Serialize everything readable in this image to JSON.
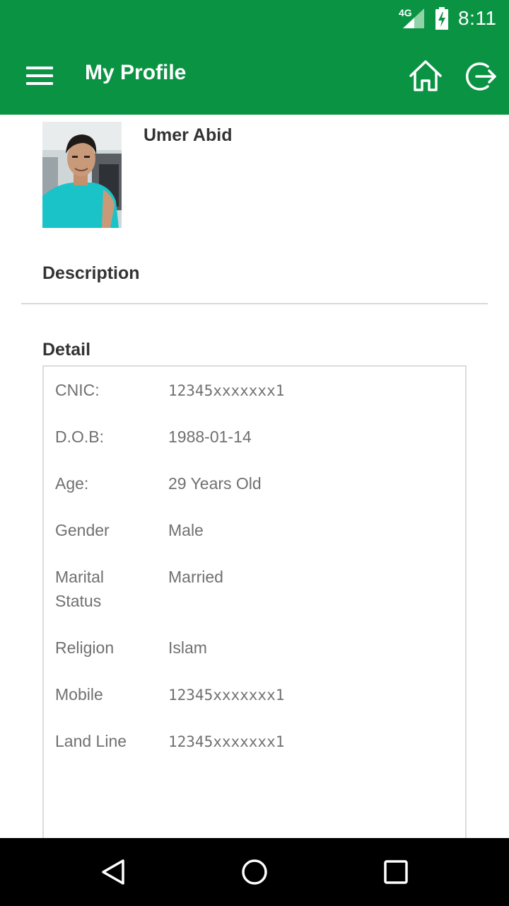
{
  "status_bar": {
    "network": "4G",
    "time": "8:11",
    "icons": [
      "signal-icon",
      "battery-charging-icon"
    ]
  },
  "app_bar": {
    "title": "My Profile",
    "icons": [
      "menu-icon",
      "home-icon",
      "logout-icon"
    ],
    "color": "#0b9344"
  },
  "profile": {
    "name": "Umer Abid"
  },
  "description": {
    "heading": "Description"
  },
  "detail": {
    "heading": "Detail",
    "rows": [
      {
        "label": "CNIC:",
        "value": "12345xxxxxxx1"
      },
      {
        "label": "D.O.B:",
        "value": "1988-01-14"
      },
      {
        "label": "Age:",
        "value": "29 Years Old"
      },
      {
        "label": "Gender",
        "value": "Male"
      },
      {
        "label": "Marital Status",
        "value": "Married"
      },
      {
        "label": "Religion",
        "value": "Islam"
      },
      {
        "label": "Mobile",
        "value": "12345xxxxxxx1"
      },
      {
        "label": "Land Line",
        "value": "12345xxxxxxx1"
      }
    ]
  },
  "nav_bar": {
    "icons": [
      "back-icon",
      "home-circle-icon",
      "recents-icon"
    ]
  }
}
